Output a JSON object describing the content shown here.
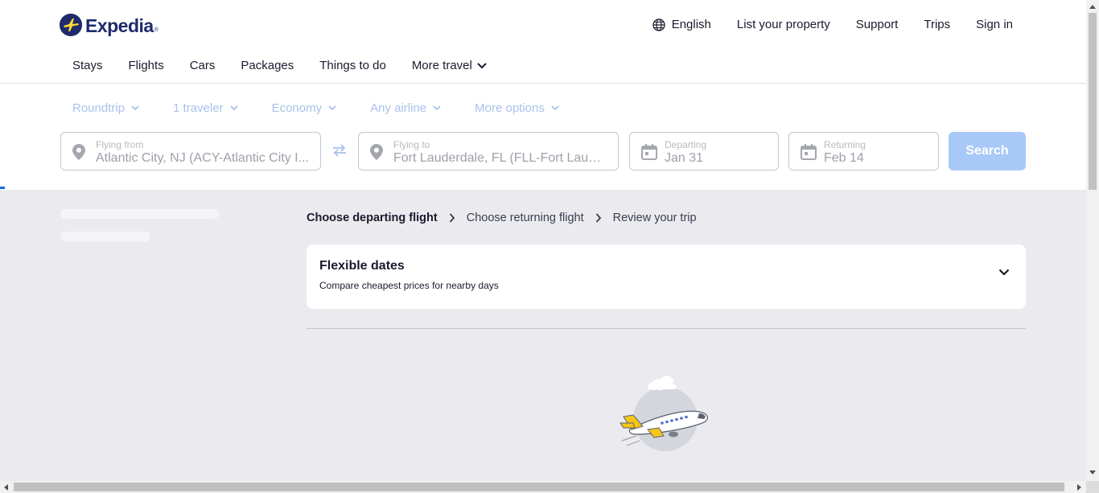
{
  "brand": {
    "name": "Expedia",
    "trademark": "®"
  },
  "top_links": {
    "language": "English",
    "list_property": "List your property",
    "support": "Support",
    "trips": "Trips",
    "sign_in": "Sign in"
  },
  "nav": {
    "items": [
      "Stays",
      "Flights",
      "Cars",
      "Packages",
      "Things to do"
    ],
    "more": "More travel"
  },
  "filters": {
    "trip_type": "Roundtrip",
    "travelers": "1 traveler",
    "cabin": "Economy",
    "airline": "Any airline",
    "more_options": "More options"
  },
  "search": {
    "from_label": "Flying from",
    "from_value": "Atlantic City, NJ (ACY-Atlantic City I...",
    "to_label": "Flying to",
    "to_value": "Fort Lauderdale, FL (FLL-Fort Lauder...",
    "depart_label": "Departing",
    "depart_value": "Jan 31",
    "return_label": "Returning",
    "return_value": "Feb 14",
    "button": "Search"
  },
  "breadcrumb": {
    "step1": "Choose departing flight",
    "step2": "Choose returning flight",
    "step3": "Review your trip"
  },
  "flexible_dates": {
    "title": "Flexible dates",
    "subtitle": "Compare cheapest prices for nearby days"
  },
  "colors": {
    "brand_navy": "#1f2b6c",
    "brand_yellow": "#fddb32",
    "accent_blue": "#1668e3",
    "search_button_disabled": "#a8c9f8",
    "background_gray": "#ebebef"
  }
}
